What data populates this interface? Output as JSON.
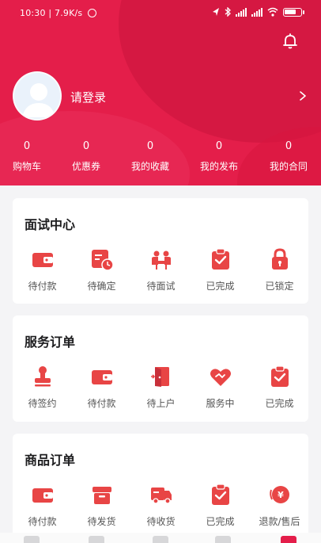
{
  "status_bar": {
    "time": "10:30 | 7.9K/s",
    "alarm_icon": "alarm-clock-icon",
    "indicators": [
      "location-icon",
      "bluetooth-icon",
      "signal-icon",
      "signal-icon",
      "wifi-icon",
      "battery-icon"
    ],
    "battery_percent": 75
  },
  "header": {
    "login_label": "请登录",
    "bell_icon": "bell-icon",
    "stats": [
      {
        "value": "0",
        "label": "购物车"
      },
      {
        "value": "0",
        "label": "优惠券"
      },
      {
        "value": "0",
        "label": "我的收藏"
      },
      {
        "value": "0",
        "label": "我的发布"
      },
      {
        "value": "0",
        "label": "我的合同"
      }
    ]
  },
  "sections": [
    {
      "title": "面试中心",
      "items": [
        {
          "label": "待付款",
          "icon": "wallet-icon"
        },
        {
          "label": "待确定",
          "icon": "calendar-clock-icon"
        },
        {
          "label": "待面试",
          "icon": "interview-icon"
        },
        {
          "label": "已完成",
          "icon": "clipboard-check-icon"
        },
        {
          "label": "已锁定",
          "icon": "lock-icon"
        }
      ]
    },
    {
      "title": "服务订单",
      "items": [
        {
          "label": "待签约",
          "icon": "stamp-icon"
        },
        {
          "label": "待付款",
          "icon": "wallet-icon"
        },
        {
          "label": "待上户",
          "icon": "door-icon"
        },
        {
          "label": "服务中",
          "icon": "handshake-heart-icon"
        },
        {
          "label": "已完成",
          "icon": "clipboard-check-icon"
        }
      ]
    },
    {
      "title": "商品订单",
      "items": [
        {
          "label": "待付款",
          "icon": "wallet-icon"
        },
        {
          "label": "待发货",
          "icon": "package-icon"
        },
        {
          "label": "待收货",
          "icon": "truck-icon"
        },
        {
          "label": "已完成",
          "icon": "clipboard-check-icon"
        },
        {
          "label": "退款/售后",
          "icon": "refund-icon"
        }
      ]
    }
  ],
  "colors": {
    "accent": "#e41e4a",
    "background": "#f4f4f6"
  }
}
